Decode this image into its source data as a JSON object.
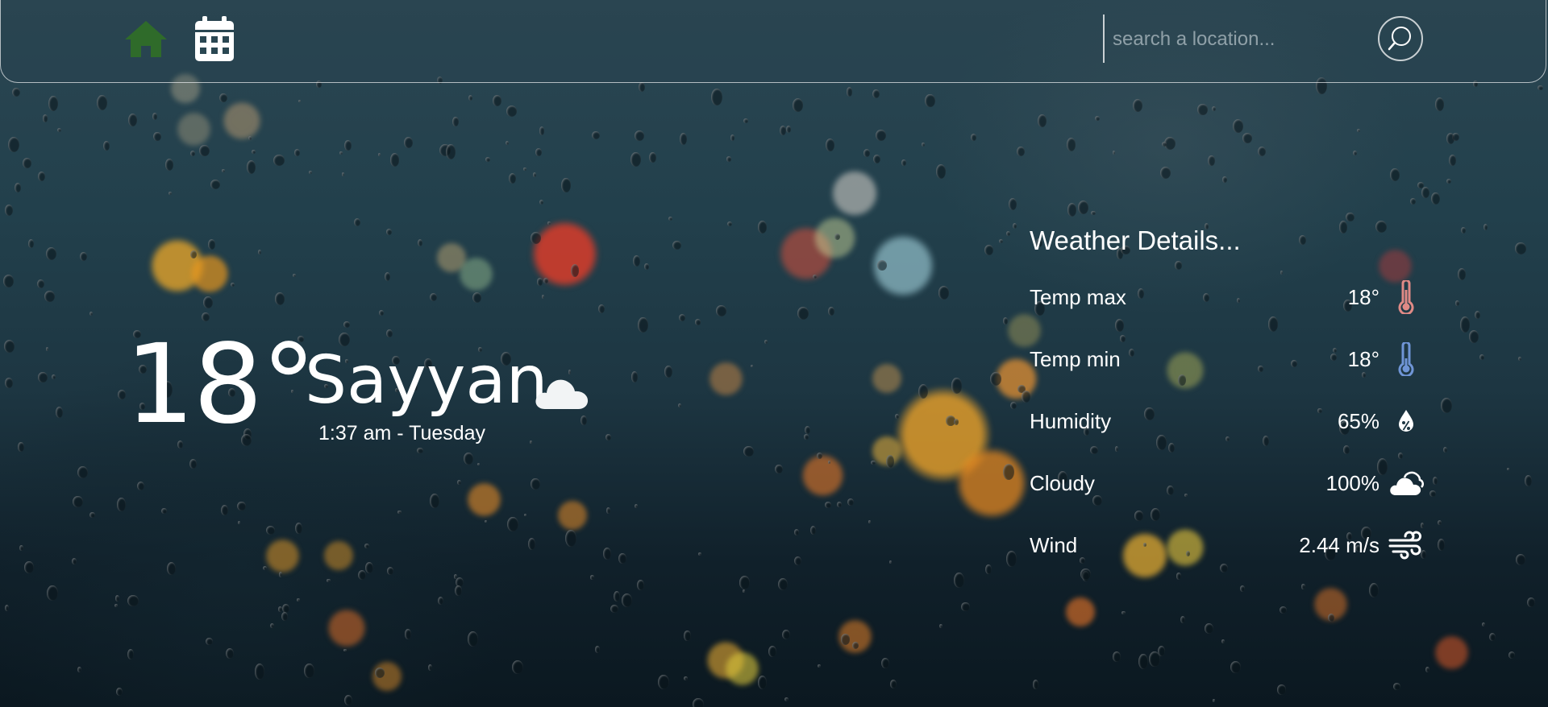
{
  "nav": {
    "search_placeholder": "search a location...",
    "home_color": "#2f6b2a"
  },
  "current": {
    "temperature": "18°",
    "city": "Sayyan",
    "datetime": "1:37 am - Tuesday",
    "condition_icon": "cloud-icon"
  },
  "details": {
    "title": "Weather Details...",
    "rows": [
      {
        "label": "Temp max",
        "value": "18°",
        "icon": "thermometer-hot-icon",
        "icon_color": "#e08a86"
      },
      {
        "label": "Temp min",
        "value": "18°",
        "icon": "thermometer-cold-icon",
        "icon_color": "#6f95d6"
      },
      {
        "label": "Humidity",
        "value": "65%",
        "icon": "humidity-drop-icon",
        "icon_color": "#ffffff"
      },
      {
        "label": "Cloudy",
        "value": "100%",
        "icon": "cloud-icon",
        "icon_color": "#ffffff"
      },
      {
        "label": "Wind",
        "value": "2.44 m/s",
        "icon": "wind-icon",
        "icon_color": "#ffffff"
      }
    ]
  }
}
